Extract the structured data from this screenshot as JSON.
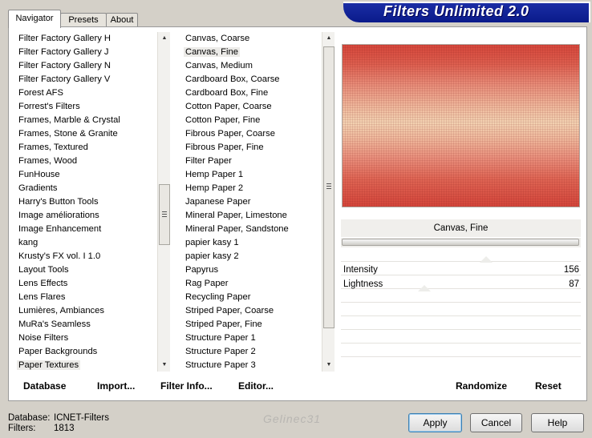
{
  "title": "Filters Unlimited 2.0",
  "tabs": [
    "Navigator",
    "Presets",
    "About"
  ],
  "categories": [
    "Filter Factory Gallery H",
    "Filter Factory Gallery J",
    "Filter Factory Gallery N",
    "Filter Factory Gallery V",
    "Forest AFS",
    "Forrest's Filters",
    "Frames, Marble & Crystal",
    "Frames, Stone & Granite",
    "Frames, Textured",
    "Frames, Wood",
    "FunHouse",
    "Gradients",
    "Harry's Button Tools",
    "Image améliorations",
    "Image Enhancement",
    "kang",
    "Krusty's FX vol. I 1.0",
    "Layout Tools",
    "Lens Effects",
    "Lens Flares",
    "Lumières, Ambiances",
    "MuRa's Seamless",
    "Noise Filters",
    "Paper Backgrounds",
    "Paper Textures"
  ],
  "categories_selected": 24,
  "filters": [
    "Canvas, Coarse",
    "Canvas, Fine",
    "Canvas, Medium",
    "Cardboard Box, Coarse",
    "Cardboard Box, Fine",
    "Cotton Paper, Coarse",
    "Cotton Paper, Fine",
    "Fibrous Paper, Coarse",
    "Fibrous Paper, Fine",
    "Filter Paper",
    "Hemp Paper 1",
    "Hemp Paper 2",
    "Japanese Paper",
    "Mineral Paper, Limestone",
    "Mineral Paper, Sandstone",
    "papier kasy 1",
    "papier kasy 2",
    "Papyrus",
    "Rag Paper",
    "Recycling Paper",
    "Striped Paper, Coarse",
    "Striped Paper, Fine",
    "Structure Paper 1",
    "Structure Paper 2",
    "Structure Paper 3"
  ],
  "filters_selected": 1,
  "selected_filter_name": "Canvas, Fine",
  "parameters": [
    {
      "label": "Intensity",
      "value": "156",
      "fraction": 0.61
    },
    {
      "label": "Lightness",
      "value": "87",
      "fraction": 0.34
    }
  ],
  "panel_buttons": {
    "database": "Database",
    "import": "Import...",
    "filter_info": "Filter Info...",
    "editor": "Editor...",
    "randomize": "Randomize",
    "reset": "Reset"
  },
  "status": {
    "database_label": "Database:",
    "database_value": "ICNET-Filters",
    "filters_label": "Filters:",
    "filters_value": "1813"
  },
  "watermark": "Gelinec31",
  "dialog_buttons": {
    "apply": "Apply",
    "cancel": "Cancel",
    "help": "Help"
  },
  "colors": {
    "banner": "#13279b",
    "preview_red": "#d6473b",
    "preview_light": "#f2d2b2"
  }
}
